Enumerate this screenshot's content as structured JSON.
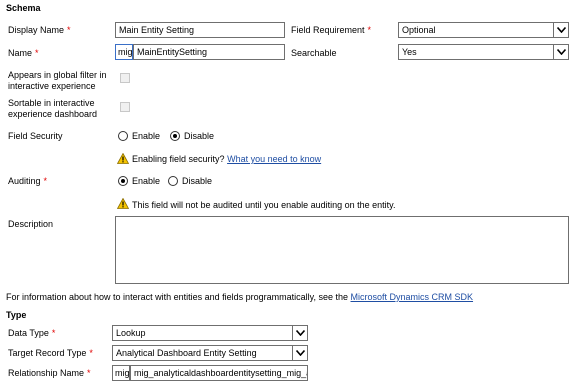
{
  "schema": {
    "title": "Schema",
    "display_name": {
      "label": "Display Name",
      "value": "Main Entity Setting"
    },
    "field_requirement": {
      "label": "Field Requirement",
      "value": "Optional"
    },
    "name": {
      "label": "Name",
      "prefix": "mig_",
      "value": "MainEntitySetting"
    },
    "searchable": {
      "label": "Searchable",
      "value": "Yes"
    },
    "global_filter": {
      "label_line1": "Appears in global filter in",
      "label_line2": "interactive experience"
    },
    "sortable": {
      "label_line1": "Sortable in interactive",
      "label_line2": "experience dashboard"
    },
    "field_security": {
      "label": "Field Security",
      "option_enable": "Enable",
      "option_disable": "Disable",
      "selected": "Disable",
      "warning_text": "Enabling field security?",
      "warning_link": "What you need to know"
    },
    "auditing": {
      "label": "Auditing",
      "option_enable": "Enable",
      "option_disable": "Disable",
      "selected": "Enable",
      "warning_text": "This field will not be audited until you enable auditing on the entity."
    },
    "description": {
      "label": "Description",
      "value": ""
    }
  },
  "info": {
    "text": "For information about how to interact with entities and fields programmatically, see the",
    "link": "Microsoft Dynamics CRM SDK"
  },
  "type": {
    "title": "Type",
    "data_type": {
      "label": "Data Type",
      "value": "Lookup"
    },
    "target_record_type": {
      "label": "Target Record Type",
      "value": "Analytical Dashboard Entity Setting"
    },
    "relationship_name": {
      "label": "Relationship Name",
      "prefix": "mig_",
      "value": "mig_analyticaldashboardentitysetting_mig_ar"
    }
  },
  "colors": {
    "required": "#e00000",
    "link": "#1f4ea3",
    "warning": "#f5c400"
  },
  "icons": {
    "dropdown": "chevron-down-icon",
    "warning": "warning-icon"
  }
}
